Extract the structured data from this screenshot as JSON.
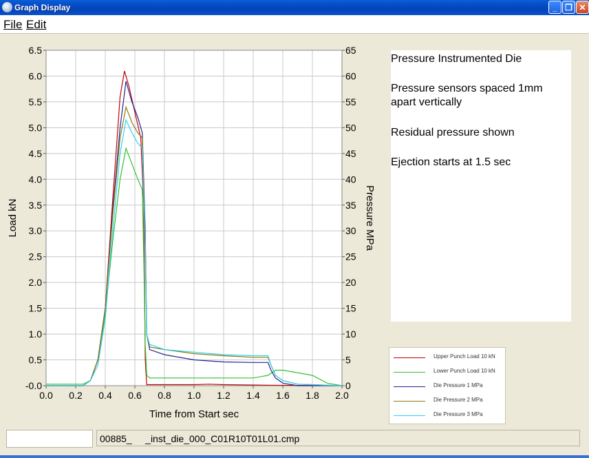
{
  "window": {
    "title": "Graph Display",
    "minimize": "_",
    "restore": "❐",
    "close": "✕"
  },
  "menu": {
    "file": "File",
    "edit": "Edit"
  },
  "info": [
    "Pressure Instrumented Die",
    "Pressure sensors spaced 1mm apart vertically",
    "Residual pressure shown",
    "Ejection starts at 1.5 sec"
  ],
  "status": {
    "left": "",
    "filename": "00885_     _inst_die_000_C01R10T01L01.cmp"
  },
  "colors": {
    "upper_punch": "#c00000",
    "lower_punch": "#30c030",
    "die1": "#23238f",
    "die2": "#8a7a10",
    "die3": "#30d0f0",
    "grid": "#c8c8c8"
  },
  "chart_data": {
    "type": "line",
    "xlabel": "Time from Start sec",
    "ylabel": "Load kN",
    "y2label": "Pressure MPa",
    "xlim": [
      0.0,
      2.0
    ],
    "ylim": [
      0.0,
      6.5
    ],
    "y2lim": [
      0,
      65
    ],
    "x_ticks": [
      "0.0",
      "0.2",
      "0.4",
      "0.6",
      "0.8",
      "1.0",
      "1.2",
      "1.4",
      "1.6",
      "1.8",
      "2.0"
    ],
    "y_ticks": [
      "-0.0",
      "0.5",
      "1.0",
      "1.5",
      "2.0",
      "2.5",
      "3.0",
      "3.5",
      "4.0",
      "4.5",
      "5.0",
      "5.5",
      "6.0",
      "6.5"
    ],
    "y2_ticks": [
      "0",
      "5",
      "10",
      "15",
      "20",
      "25",
      "30",
      "35",
      "40",
      "45",
      "50",
      "55",
      "60",
      "65"
    ],
    "grid": true,
    "legend_position": "bottom-right",
    "series": [
      {
        "name": "Upper Punch Load 10 kN",
        "axis": "left",
        "color": "#c00000",
        "x": [
          0,
          0.1,
          0.25,
          0.3,
          0.35,
          0.4,
          0.45,
          0.5,
          0.53,
          0.56,
          0.6,
          0.64,
          0.66,
          0.67,
          0.68,
          0.8,
          1.0,
          1.1,
          1.2,
          1.5,
          2.0
        ],
        "y": [
          0,
          0,
          0,
          0.1,
          0.5,
          1.5,
          3.6,
          5.6,
          6.1,
          5.8,
          5.3,
          4.8,
          3.5,
          0.5,
          0.02,
          0.02,
          0.02,
          0.03,
          0.02,
          0.01,
          0
        ]
      },
      {
        "name": "Lower Punch Load 10 kN",
        "axis": "left",
        "color": "#30c030",
        "x": [
          0,
          0.25,
          0.3,
          0.35,
          0.4,
          0.45,
          0.5,
          0.54,
          0.58,
          0.62,
          0.65,
          0.66,
          0.67,
          0.68,
          0.7,
          1.0,
          1.4,
          1.5,
          1.55,
          1.6,
          1.8,
          1.9,
          2.0
        ],
        "y": [
          0.03,
          0.03,
          0.1,
          0.5,
          1.4,
          2.8,
          4.0,
          4.6,
          4.3,
          4.0,
          3.8,
          2.5,
          0.8,
          0.2,
          0.15,
          0.15,
          0.15,
          0.2,
          0.3,
          0.3,
          0.2,
          0.05,
          0.0
        ]
      },
      {
        "name": "Die Pressure 1 MPa",
        "axis": "right",
        "color": "#23238f",
        "x": [
          0,
          0.25,
          0.3,
          0.35,
          0.4,
          0.45,
          0.5,
          0.54,
          0.58,
          0.62,
          0.65,
          0.67,
          0.68,
          0.7,
          0.8,
          1.0,
          1.2,
          1.4,
          1.5,
          1.52,
          1.55,
          1.6,
          1.7,
          2.0
        ],
        "y": [
          0,
          0,
          1,
          5,
          15,
          34,
          50,
          59,
          55,
          52,
          49,
          30,
          10,
          7,
          6,
          5,
          4.6,
          4.5,
          4.5,
          3,
          1.5,
          0.5,
          0,
          0
        ]
      },
      {
        "name": "Die Pressure 2 MPa",
        "axis": "right",
        "color": "#8a7a10",
        "x": [
          0,
          0.25,
          0.3,
          0.35,
          0.4,
          0.45,
          0.5,
          0.54,
          0.58,
          0.62,
          0.65,
          0.67,
          0.68,
          0.7,
          0.8,
          1.0,
          1.2,
          1.4,
          1.5,
          1.52,
          1.55,
          1.6,
          1.7,
          2.0
        ],
        "y": [
          0,
          0,
          1,
          5,
          15,
          33,
          48,
          54,
          51,
          49,
          48,
          28,
          10,
          7.5,
          7,
          6.2,
          5.8,
          5.5,
          5.5,
          4,
          2,
          1,
          0.3,
          0
        ]
      },
      {
        "name": "Die Pressure 3 MPa",
        "axis": "right",
        "color": "#30d0f0",
        "x": [
          0,
          0.25,
          0.3,
          0.35,
          0.4,
          0.45,
          0.5,
          0.54,
          0.58,
          0.62,
          0.65,
          0.67,
          0.68,
          0.7,
          0.8,
          1.0,
          1.2,
          1.4,
          1.5,
          1.52,
          1.55,
          1.6,
          1.7,
          2.0
        ],
        "y": [
          0,
          0,
          1,
          4,
          13,
          30,
          45,
          51.5,
          49,
          47,
          46,
          27,
          10,
          8,
          7,
          6.5,
          6,
          5.8,
          5.8,
          4,
          2,
          1,
          0.3,
          0
        ]
      }
    ]
  }
}
